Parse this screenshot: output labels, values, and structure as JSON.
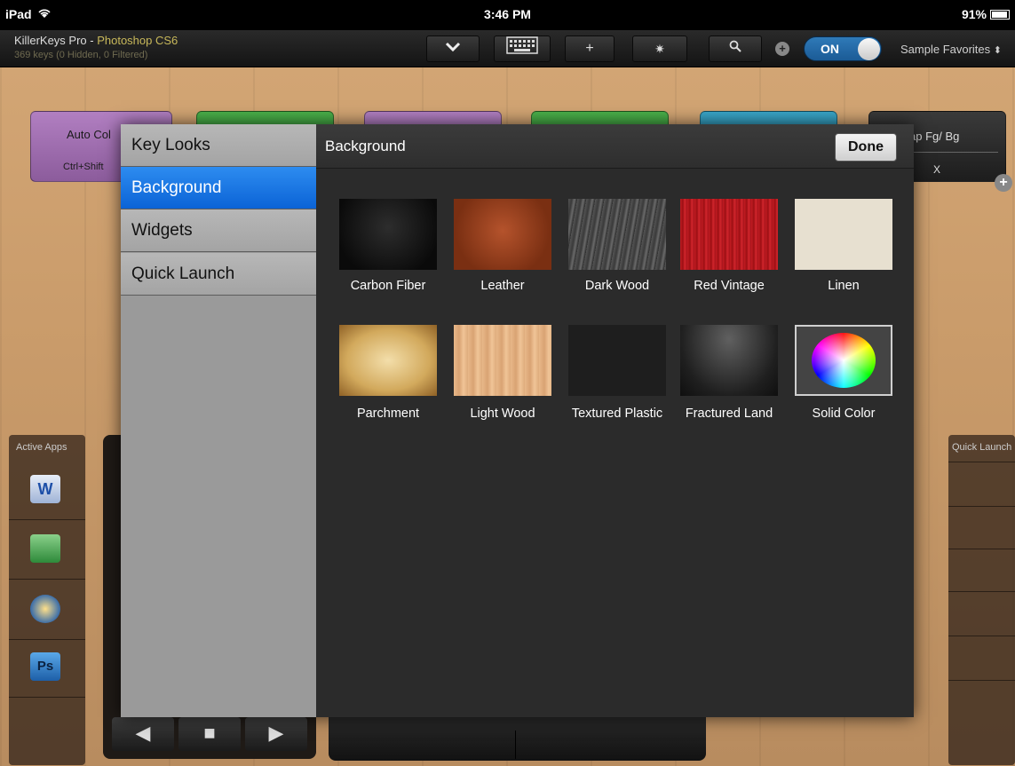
{
  "status_bar": {
    "device": "iPad",
    "wifi": "wifi-icon",
    "time": "3:46 PM",
    "battery": "91%"
  },
  "toolbar": {
    "app_name": "KillerKeys Pro - ",
    "app_target": "Photoshop CS6",
    "subtitle": "369 keys (0 Hidden, 0 Filtered)",
    "toggle_label": "ON",
    "favorites_label": "Sample Favorites",
    "buttons": {
      "collapse": "chevron-down-icon",
      "keyboard": "keyboard-icon",
      "add": "+",
      "settings": "gear-icon",
      "search": "search-icon",
      "add_circle": "add-circle-icon"
    }
  },
  "background_keys": {
    "auto_key_label": "Auto Col",
    "auto_key_shortcut": "Ctrl+Shift",
    "swap_key_label": "ap Fg/ Bg",
    "swap_key_shortcut": "X"
  },
  "side_panels": {
    "active_apps_title": "Active Apps",
    "quick_launch_title": "Quick Launch",
    "apps": [
      "W",
      "",
      "",
      "Ps"
    ]
  },
  "menu": {
    "items": [
      {
        "label": "Key Looks"
      },
      {
        "label": "Background"
      },
      {
        "label": "Widgets"
      },
      {
        "label": "Quick Launch"
      }
    ],
    "selected": "Background"
  },
  "content": {
    "title": "Background",
    "done_label": "Done",
    "backgrounds": [
      {
        "label": "Carbon Fiber"
      },
      {
        "label": "Leather"
      },
      {
        "label": "Dark Wood"
      },
      {
        "label": "Red Vintage"
      },
      {
        "label": "Linen"
      },
      {
        "label": "Parchment"
      },
      {
        "label": "Light Wood"
      },
      {
        "label": "Textured Plastic"
      },
      {
        "label": "Fractured Land"
      },
      {
        "label": "Solid Color"
      }
    ],
    "selected_background": "Solid Color"
  },
  "transport": {
    "prev": "◀",
    "stop": "■",
    "next": "▶"
  }
}
